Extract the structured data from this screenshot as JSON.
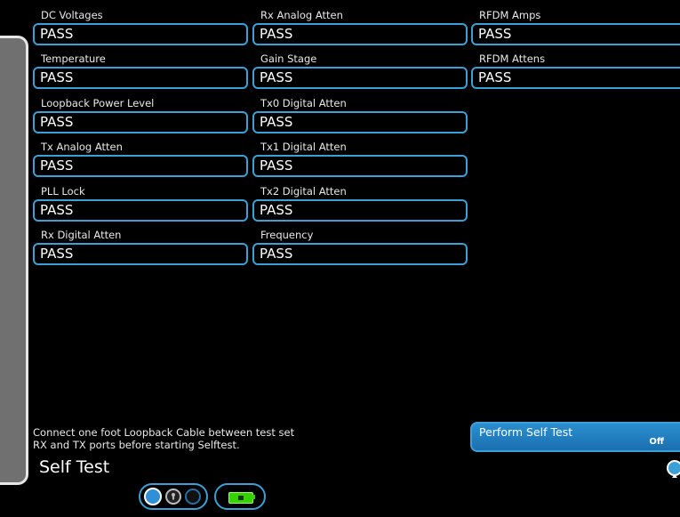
{
  "page": {
    "title": "Self Test"
  },
  "results": {
    "col1": [
      {
        "label": "DC Voltages",
        "value": "PASS"
      },
      {
        "label": "Temperature",
        "value": "PASS"
      },
      {
        "label": "Loopback Power Level",
        "value": "PASS"
      },
      {
        "label": "Tx Analog Atten",
        "value": "PASS"
      },
      {
        "label": "PLL Lock",
        "value": "PASS"
      },
      {
        "label": "Rx Digital Atten",
        "value": "PASS"
      }
    ],
    "col2": [
      {
        "label": "Rx Analog Atten",
        "value": "PASS"
      },
      {
        "label": "Gain Stage",
        "value": "PASS"
      },
      {
        "label": "Tx0 Digital Atten",
        "value": "PASS"
      },
      {
        "label": "Tx1 Digital Atten",
        "value": "PASS"
      },
      {
        "label": "Tx2 Digital Atten",
        "value": "PASS"
      },
      {
        "label": "Frequency",
        "value": "PASS"
      }
    ],
    "col3": [
      {
        "label": "RFDM Amps",
        "value": "PASS"
      },
      {
        "label": "RFDM Attens",
        "value": "PASS"
      }
    ]
  },
  "instructions": {
    "line1": "Connect one foot Loopback Cable between test set",
    "line2": "RX and TX ports before starting Selftest."
  },
  "perform_button": {
    "label": "Perform Self Test",
    "state": "Off"
  },
  "icons": {
    "scroll_up": "chevron-up-icon",
    "toggle": "mode-toggle-icon",
    "battery": "battery-icon"
  },
  "colors": {
    "accent": "#3aa0d6",
    "battery": "#36d200",
    "rail": "#707070"
  }
}
